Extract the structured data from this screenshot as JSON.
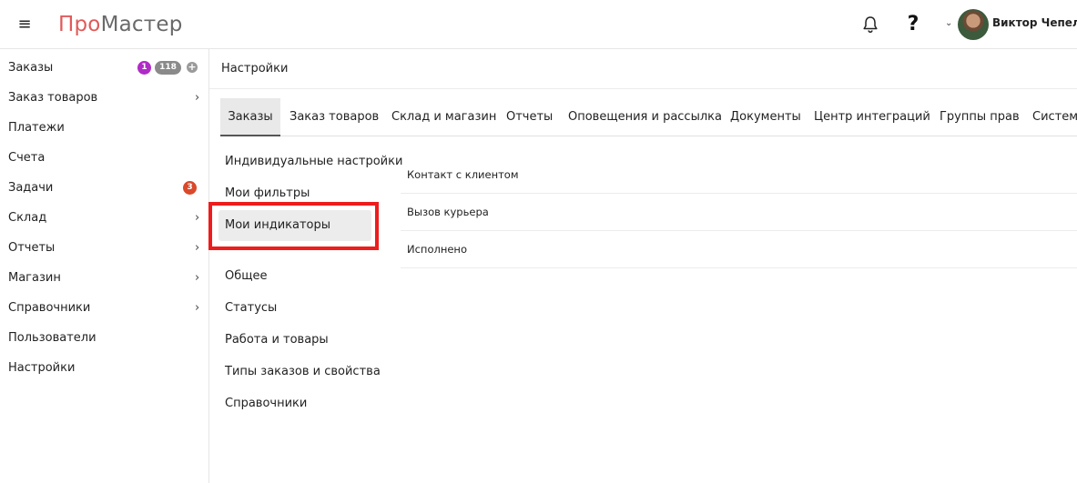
{
  "app": {
    "logo_part1": "Про",
    "logo_part2": "Мастер",
    "accent_color": "#e05a5a"
  },
  "header": {
    "menu_icon": "hamburger-icon",
    "notifications_icon": "bell-icon",
    "help_label": "?",
    "user_name": "Виктор Чепел"
  },
  "sidebar": {
    "items": [
      {
        "label": "Заказы",
        "badge_new": "1",
        "badge_total": "118",
        "has_add": true
      },
      {
        "label": "Заказ товаров",
        "has_submenu": true
      },
      {
        "label": "Платежи"
      },
      {
        "label": "Счета"
      },
      {
        "label": "Задачи",
        "badge": "3"
      },
      {
        "label": "Склад",
        "has_submenu": true
      },
      {
        "label": "Отчеты",
        "has_submenu": true
      },
      {
        "label": "Магазин",
        "has_submenu": true
      },
      {
        "label": "Справочники",
        "has_submenu": true
      },
      {
        "label": "Пользователи"
      },
      {
        "label": "Настройки"
      }
    ],
    "chevron": "›",
    "plus": "+"
  },
  "main": {
    "title": "Настройки",
    "tabs": [
      {
        "label": "Заказы",
        "active": true
      },
      {
        "label": "Заказ товаров"
      },
      {
        "label": "Склад и магазин"
      },
      {
        "label": "Отчеты"
      },
      {
        "label": "Оповещения и рассылка"
      },
      {
        "label": "Документы"
      },
      {
        "label": "Центр интеграций"
      },
      {
        "label": "Группы прав"
      },
      {
        "label": "Система"
      }
    ],
    "subnav": [
      {
        "label": "Индивидуальные настройки"
      },
      {
        "label": "Мои фильтры"
      },
      {
        "label": "Мои индикаторы",
        "selected": true
      },
      {
        "label": "Общее"
      },
      {
        "label": "Статусы"
      },
      {
        "label": "Работа и товары"
      },
      {
        "label": "Типы заказов и свойства"
      },
      {
        "label": "Справочники"
      }
    ],
    "indicators": [
      {
        "label": "Контакт с клиентом"
      },
      {
        "label": "Вызов курьера"
      },
      {
        "label": "Исполнено"
      }
    ]
  },
  "colors": {
    "badge_purple": "#b02ac8",
    "badge_gray": "#8a8a8a",
    "badge_orange": "#d9492a",
    "highlight_red": "#ee1c1c"
  }
}
